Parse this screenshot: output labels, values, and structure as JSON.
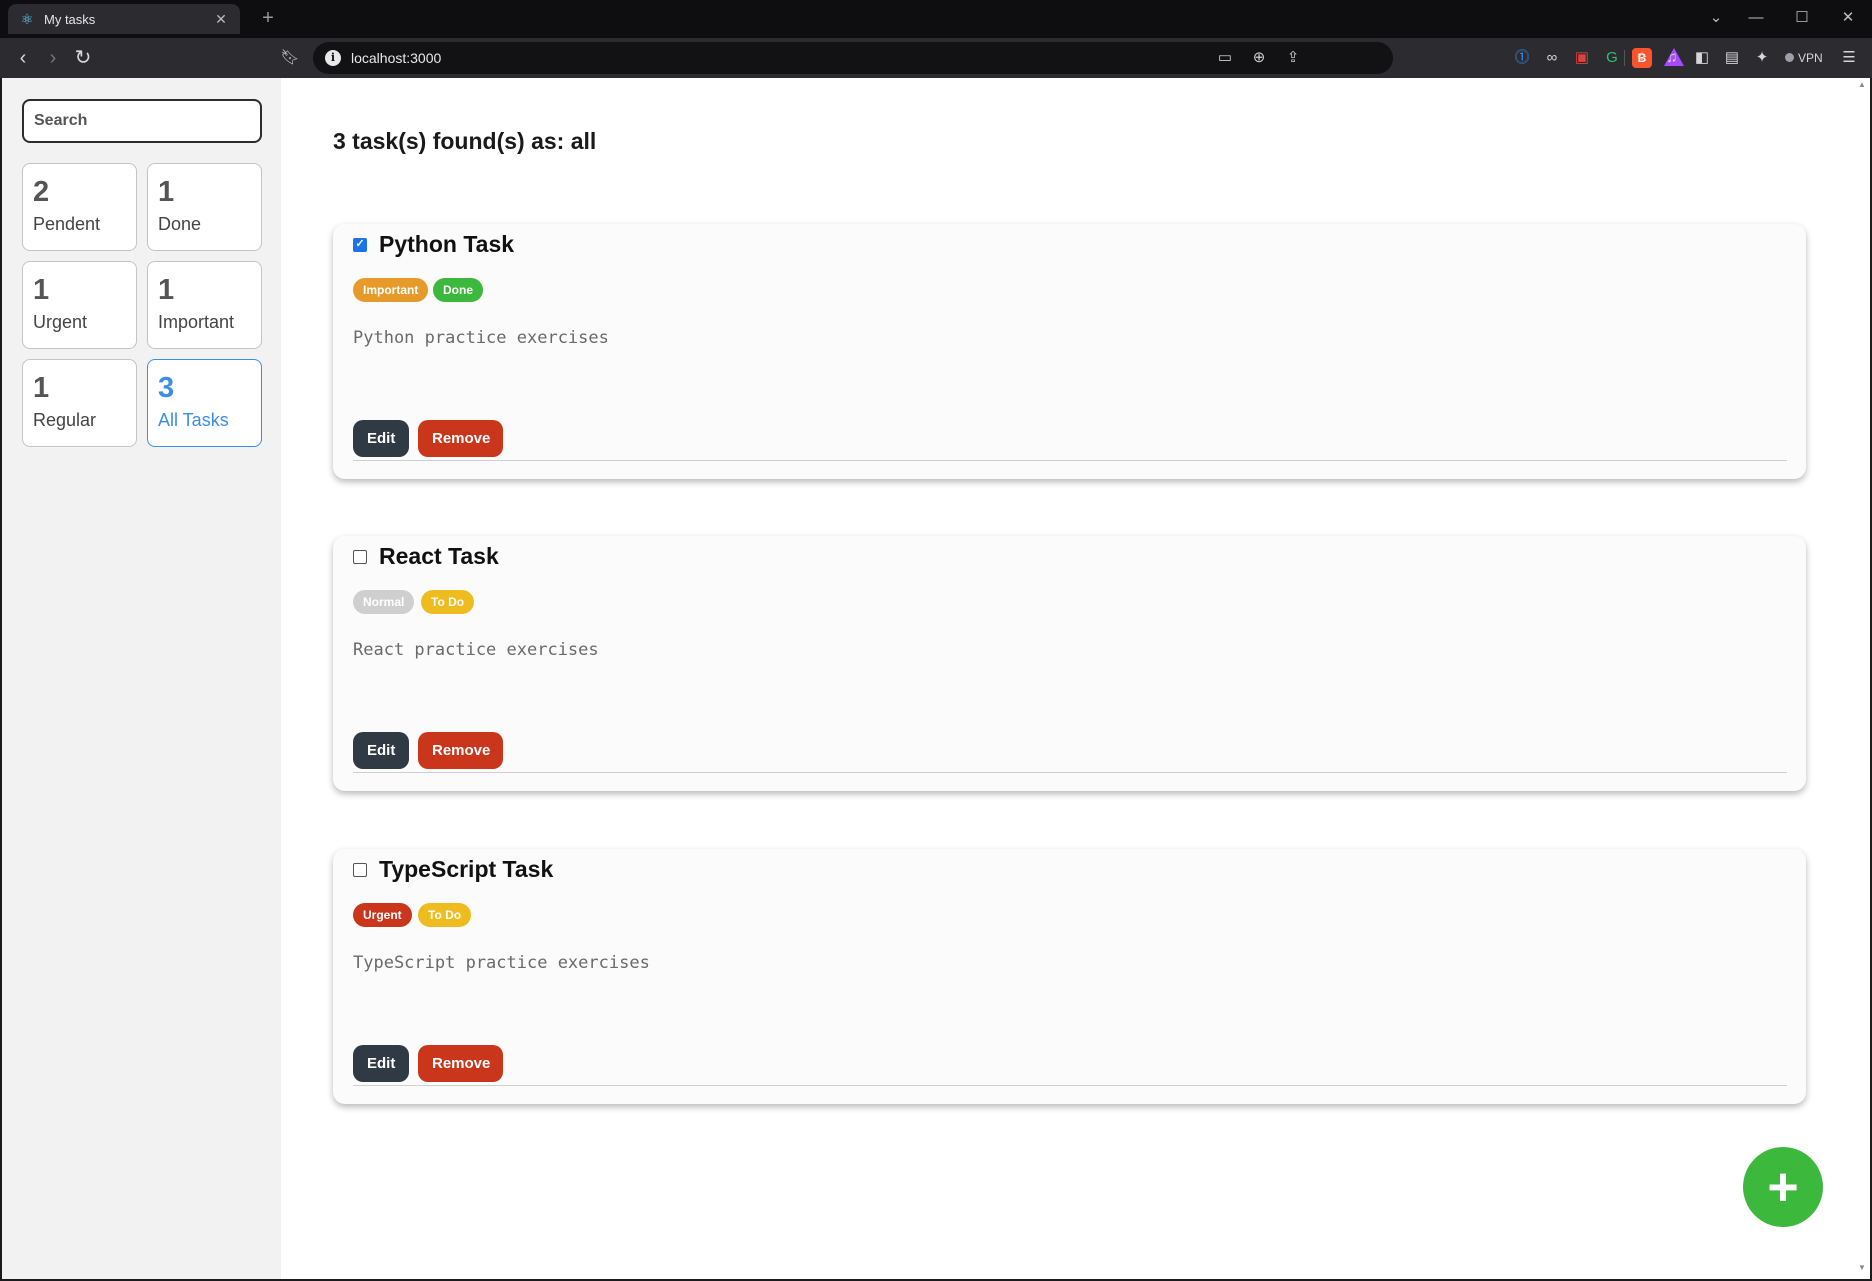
{
  "browser": {
    "tab_title": "My tasks",
    "tab_icon": "react-logo-icon",
    "url": "localhost:3000",
    "vpn_label": "VPN"
  },
  "search": {
    "placeholder": "Search"
  },
  "stats": [
    {
      "value": "2",
      "label": "Pendent"
    },
    {
      "value": "1",
      "label": "Done"
    },
    {
      "value": "1",
      "label": "Urgent"
    },
    {
      "value": "1",
      "label": "Important"
    },
    {
      "value": "1",
      "label": "Regular"
    },
    {
      "value": "3",
      "label": "All Tasks",
      "active": true
    }
  ],
  "heading": "3 task(s) found(s) as: all",
  "tasks": [
    {
      "title": "Python Task",
      "checked": true,
      "priority": {
        "label": "Important",
        "color": "#e69a2a"
      },
      "status": {
        "label": "Done",
        "color": "#3cb83c"
      },
      "description": "Python practice exercises",
      "edit_label": "Edit",
      "remove_label": "Remove"
    },
    {
      "title": "React Task",
      "checked": false,
      "priority": {
        "label": "Normal",
        "color": "#cfcfcf"
      },
      "status": {
        "label": "To Do",
        "color": "#eebc1e"
      },
      "description": "React practice exercises",
      "edit_label": "Edit",
      "remove_label": "Remove"
    },
    {
      "title": "TypeScript Task",
      "checked": false,
      "priority": {
        "label": "Urgent",
        "color": "#c9361b"
      },
      "status": {
        "label": "To Do",
        "color": "#eebc1e"
      },
      "description": "TypeScript practice exercises",
      "edit_label": "Edit",
      "remove_label": "Remove"
    }
  ],
  "fab_label": "+",
  "colors": {
    "accent_blue": "#3b8de5",
    "edit_button": "#2f3a45",
    "remove_button": "#c9361b",
    "fab": "#3cb83c"
  }
}
